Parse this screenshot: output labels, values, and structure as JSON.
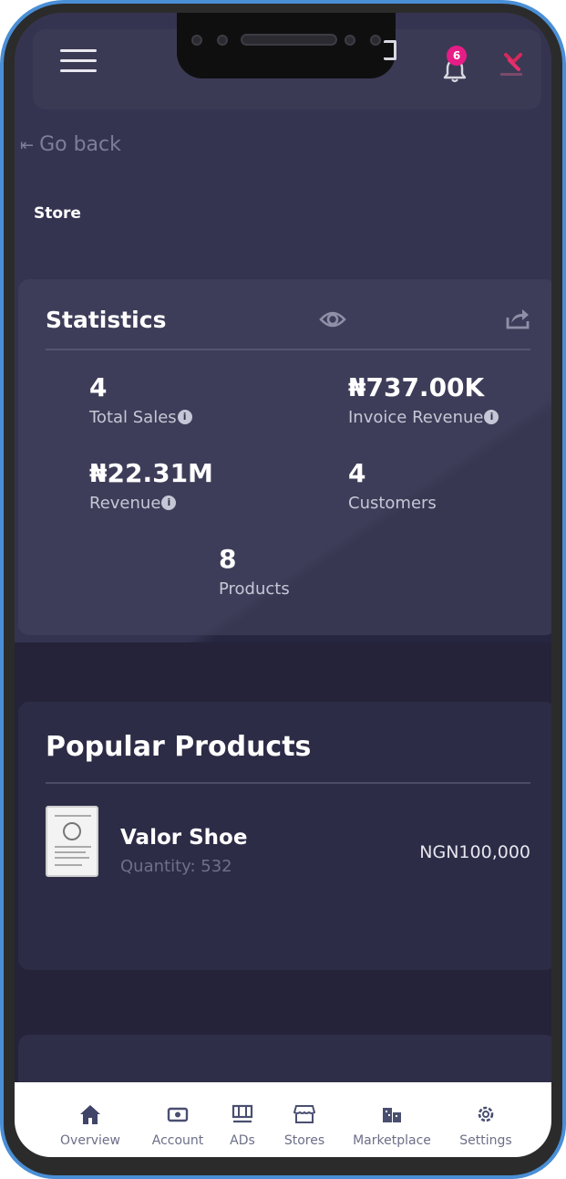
{
  "header": {
    "notification_count": "6"
  },
  "nav": {
    "go_back_label": "Go back",
    "page_title": "Store"
  },
  "statistics": {
    "title": "Statistics",
    "items": [
      {
        "value": "4",
        "label": "Total Sales",
        "info": true
      },
      {
        "value": "₦737.00K",
        "label": "Invoice Revenue",
        "info": true
      },
      {
        "value": "₦22.31M",
        "label": "Revenue",
        "info": true
      },
      {
        "value": "4",
        "label": "Customers",
        "info": false
      },
      {
        "value": "8",
        "label": "Products",
        "info": false
      }
    ]
  },
  "popular_products": {
    "title": "Popular Products",
    "items": [
      {
        "name": "Valor Shoe",
        "quantity": "Quantity: 532",
        "price": "NGN100,000"
      }
    ]
  },
  "bottom_nav": {
    "items": [
      {
        "label": "Overview",
        "icon": "home-icon"
      },
      {
        "label": "Account",
        "icon": "wallet-icon"
      },
      {
        "label": "ADs",
        "icon": "billboard-icon"
      },
      {
        "label": "Stores",
        "icon": "storefront-icon"
      },
      {
        "label": "Marketplace",
        "icon": "buildings-icon"
      },
      {
        "label": "Settings",
        "icon": "gear-icon"
      }
    ]
  },
  "colors": {
    "badge": "#e61d86",
    "background": "#353450",
    "frame": "#4a8fd6"
  }
}
